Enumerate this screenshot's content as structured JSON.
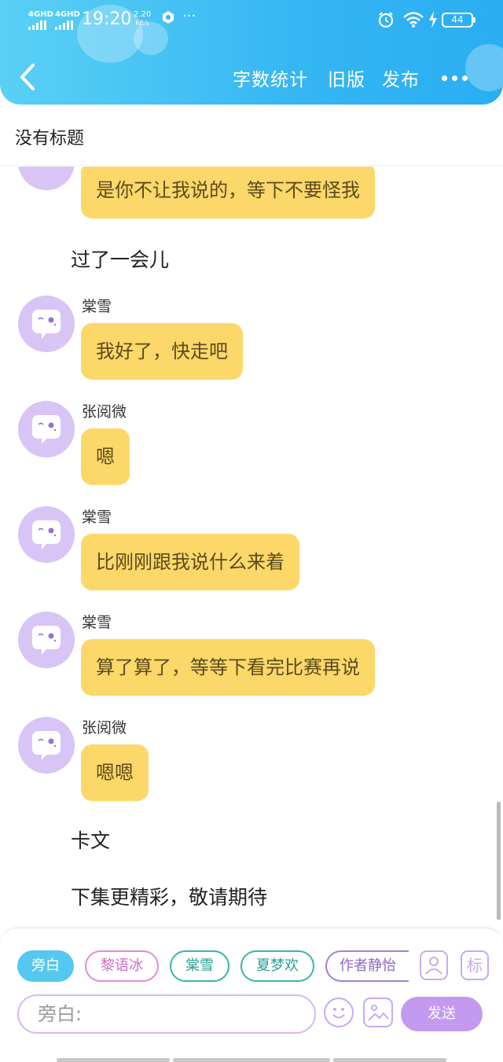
{
  "status_bar": {
    "network1": "4GHD",
    "network2": "4GHD",
    "time": "19:20",
    "speed_value": "2.20",
    "speed_unit": "KB/s",
    "ellipsis": "···",
    "battery": "44"
  },
  "header": {
    "word_count": "字数统计",
    "old_version": "旧版",
    "publish": "发布"
  },
  "story_title": "没有标题",
  "messages": [
    {
      "kind": "bubble",
      "text": "是你不让我说的，等下不要怪我"
    },
    {
      "kind": "narration",
      "text": "过了一会儿"
    },
    {
      "kind": "bubble",
      "name": "棠雪",
      "text": "我好了，快走吧"
    },
    {
      "kind": "bubble",
      "name": "张阅微",
      "text": "嗯"
    },
    {
      "kind": "bubble",
      "name": "棠雪",
      "text": "比刚刚跟我说什么来着"
    },
    {
      "kind": "bubble",
      "name": "棠雪",
      "text": "算了算了，等等下看完比赛再说"
    },
    {
      "kind": "bubble",
      "name": "张阅微",
      "text": "嗯嗯"
    },
    {
      "kind": "narration",
      "text": "卡文"
    },
    {
      "kind": "narration",
      "text": "下集更精彩，敬请期待"
    }
  ],
  "characters": [
    {
      "label": "旁白",
      "active": true,
      "color": "#54c8f0"
    },
    {
      "label": "黎语冰",
      "active": false,
      "color": "#e58ad6"
    },
    {
      "label": "棠雪",
      "active": false,
      "color": "#38b5a8"
    },
    {
      "label": "夏梦欢",
      "active": false,
      "color": "#38b5a8"
    },
    {
      "label": "作者静怡",
      "active": false,
      "color": "#a57fd6"
    }
  ],
  "composer": {
    "placeholder": "旁白:",
    "send_label": "发送",
    "tag_label": "标"
  },
  "colors": {
    "header": "#35b6f3",
    "chat_bubble": "#fcd86a",
    "avatar": "#d9c4f6",
    "send_button": "#c39af0"
  }
}
